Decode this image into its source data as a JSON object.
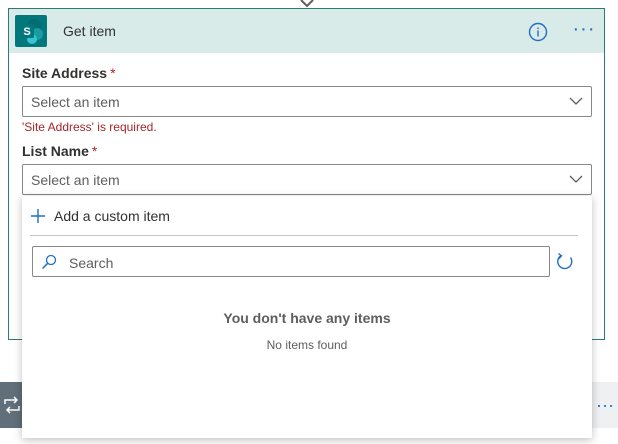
{
  "card": {
    "title": "Get item",
    "more_label": "···"
  },
  "site_address": {
    "label": "Site Address",
    "required_mark": "*",
    "placeholder": "Select an item",
    "error": "'Site Address' is required."
  },
  "list_name": {
    "label": "List Name",
    "required_mark": "*",
    "placeholder": "Select an item"
  },
  "popup": {
    "add_custom_label": "Add a custom item",
    "search_placeholder": "Search",
    "empty_title": "You don't have any items",
    "empty_subtitle": "No items found"
  },
  "next_card": {
    "more_label": "···"
  },
  "colors": {
    "accent": "#1f6fc5",
    "header_bg": "#d9ebe9",
    "card_border": "#2b7d74",
    "sharepoint": "#03787c",
    "error": "#a4262c"
  },
  "icons": [
    "sharepoint-logo-icon",
    "info-icon",
    "more-icon",
    "chevron-down-icon",
    "plus-icon",
    "search-icon",
    "refresh-icon",
    "loop-icon"
  ]
}
